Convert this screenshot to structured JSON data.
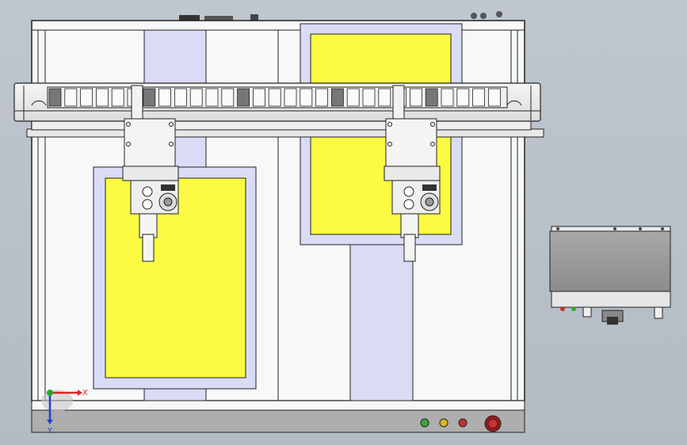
{
  "triad": {
    "x_label": "X",
    "y_label": "Y",
    "x_color": "#e0242b",
    "y_color": "#1f3fd0",
    "z_color": "#22a82b"
  },
  "colors": {
    "background": "#bcc4cd",
    "frame": "#f7f8f8",
    "lavender_plate": "#dadcf6",
    "yellow_pad": "#fbfb43",
    "controller_body": "#9a9a9a",
    "indicator_green": "#3aa83a",
    "indicator_yellow": "#d8b820",
    "indicator_red": "#c83030"
  },
  "status_lights": [
    {
      "name": "green-light",
      "color": "#3aa83a"
    },
    {
      "name": "yellow-light",
      "color": "#d8b820"
    },
    {
      "name": "red-light",
      "color": "#c83030"
    }
  ]
}
